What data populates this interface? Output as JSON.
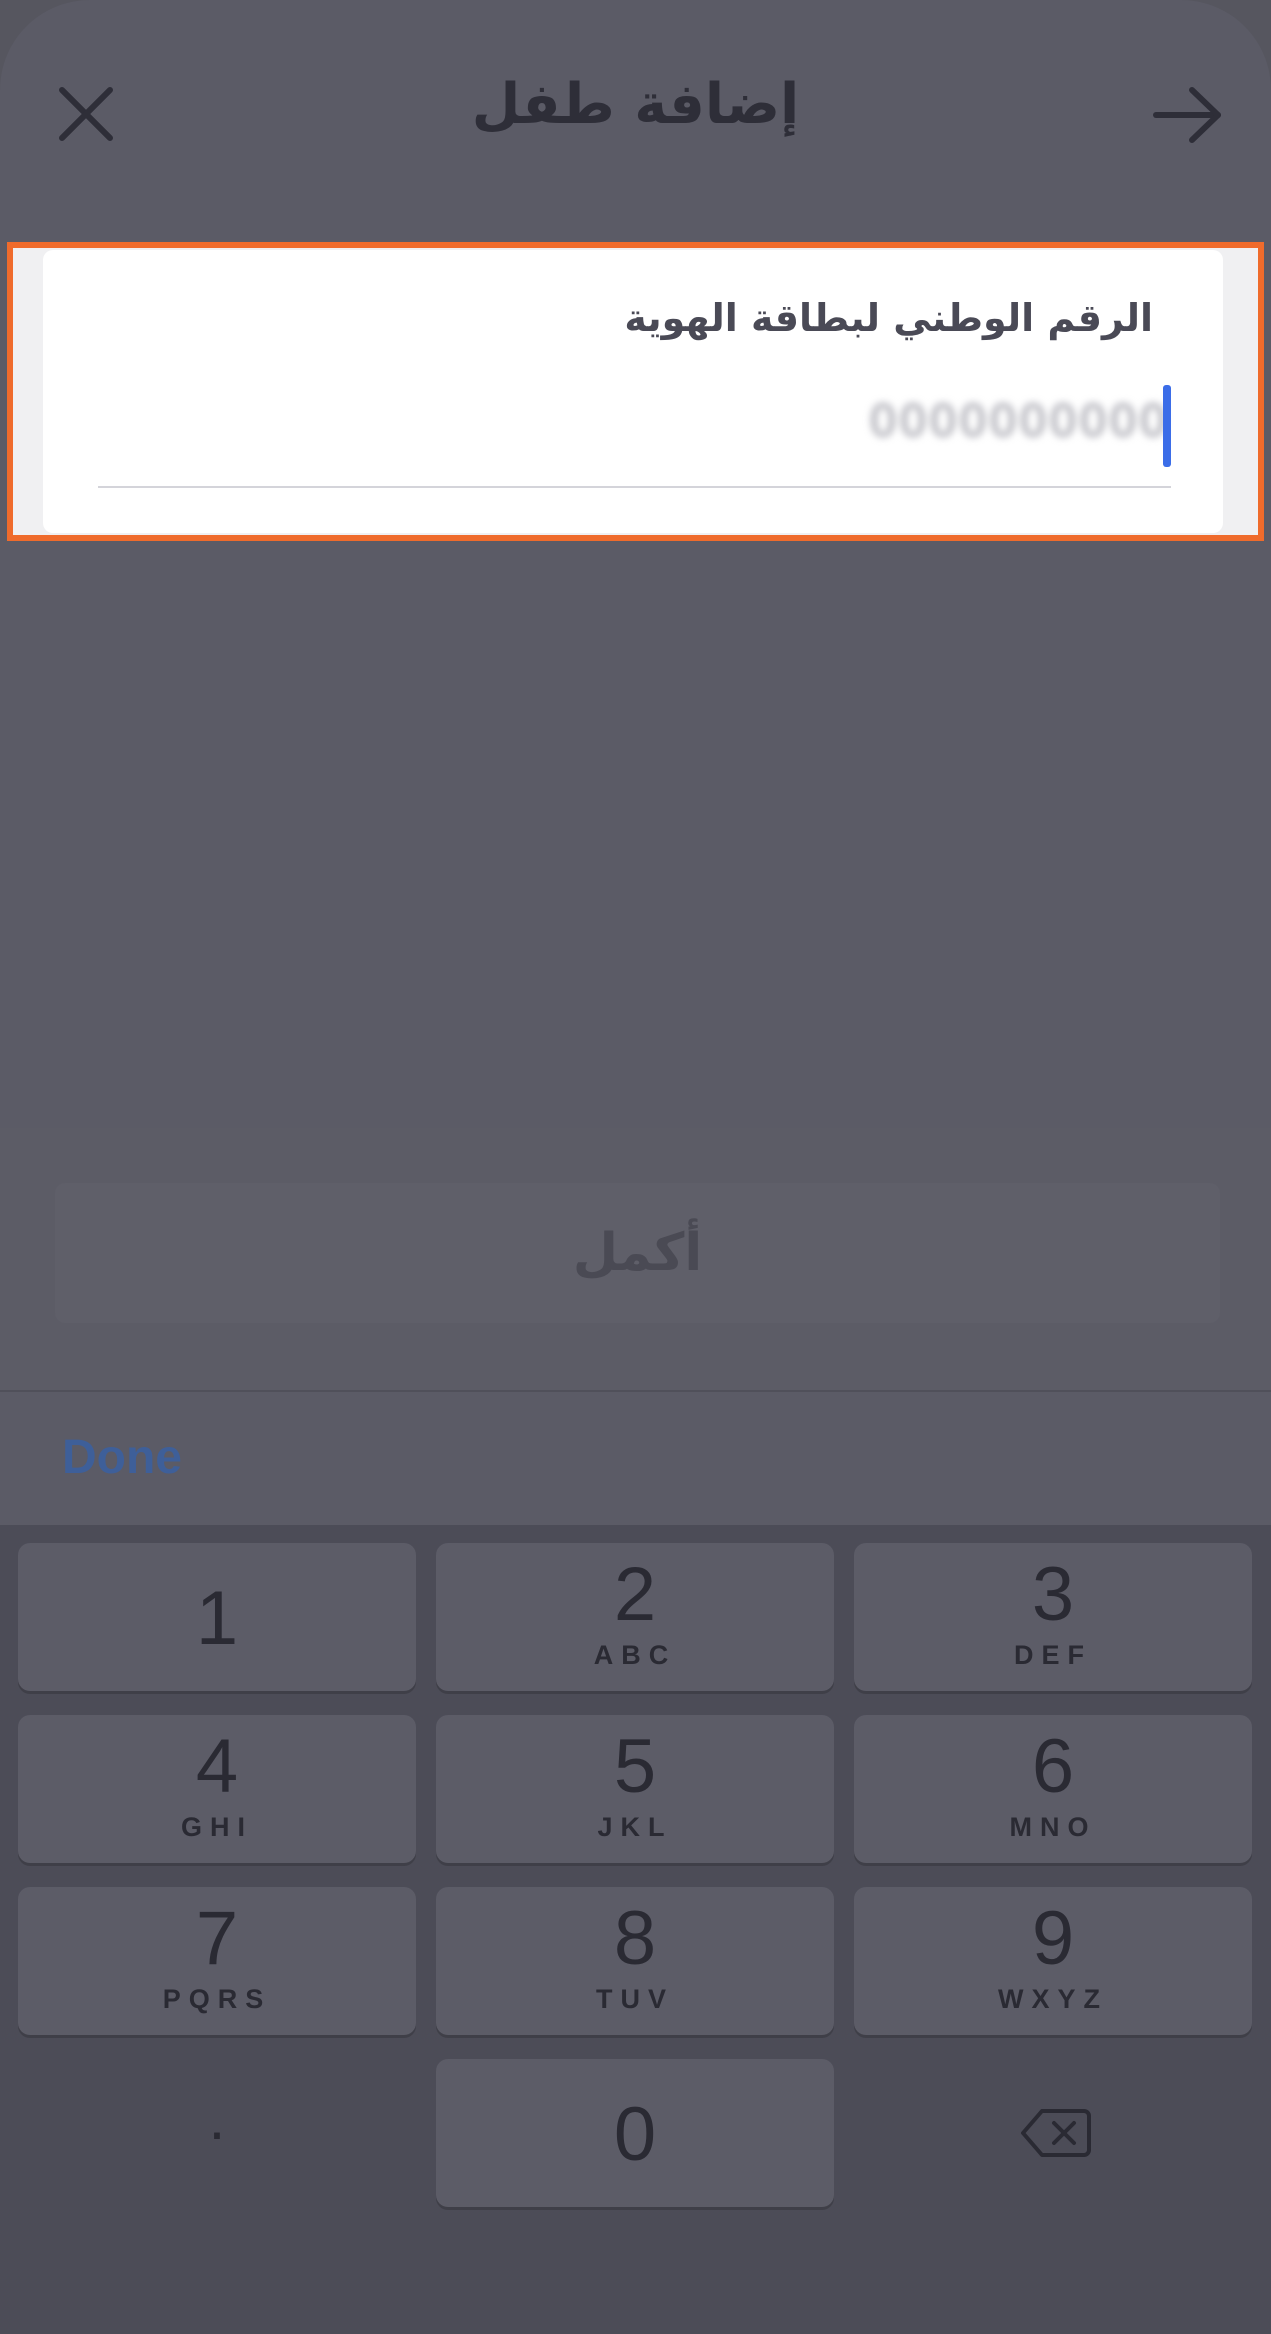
{
  "header": {
    "title": "إضافة طفل",
    "close_icon": "close-icon",
    "back_icon": "arrow-right-icon"
  },
  "form": {
    "field_label": "الرقم الوطني لبطاقة الهوية",
    "field_value": "0000000000",
    "highlight_color": "#ef6b2c",
    "caret_color": "#3b6de8"
  },
  "actions": {
    "continue_label": "أكمل"
  },
  "keyboard": {
    "done_label": "Done",
    "keys": [
      {
        "num": "1",
        "letters": ""
      },
      {
        "num": "2",
        "letters": "ABC"
      },
      {
        "num": "3",
        "letters": "DEF"
      },
      {
        "num": "4",
        "letters": "GHI"
      },
      {
        "num": "5",
        "letters": "JKL"
      },
      {
        "num": "6",
        "letters": "MNO"
      },
      {
        "num": "7",
        "letters": "PQRS"
      },
      {
        "num": "8",
        "letters": "TUV"
      },
      {
        "num": "9",
        "letters": "WXYZ"
      }
    ],
    "dot": ".",
    "zero": "0",
    "delete_icon": "backspace-icon"
  }
}
